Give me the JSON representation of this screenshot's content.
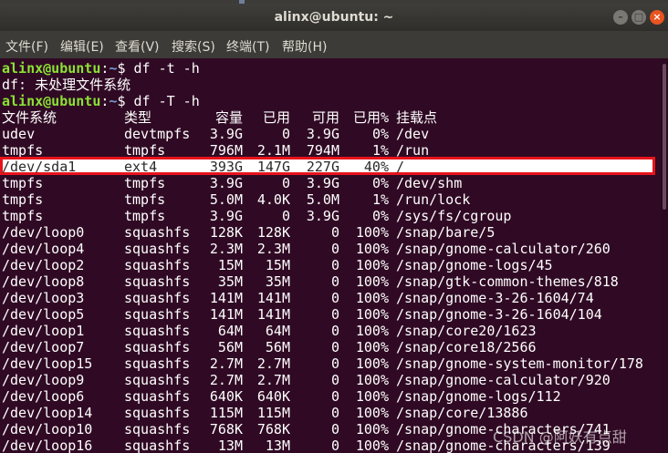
{
  "window": {
    "title": "alinx@ubuntu: ~",
    "minimize_label": "–",
    "maximize_label": "□",
    "close_label": "×"
  },
  "menu": [
    "文件(F)",
    "编辑(E)",
    "查看(V)",
    "搜索(S)",
    "终端(T)",
    "帮助(H)"
  ],
  "prompt": {
    "user_host": "alinx@ubuntu",
    "colon": ":",
    "path": "~",
    "dollar": "$"
  },
  "commands": [
    "df -t -h",
    "df -T -h"
  ],
  "error_line": "df: 未处理文件系统",
  "table": {
    "headers": [
      "文件系统",
      "类型",
      "容量",
      "已用",
      "可用",
      "已用%",
      "挂载点"
    ],
    "rows": [
      [
        "udev",
        "devtmpfs",
        "3.9G",
        "0",
        "3.9G",
        "0%",
        "/dev"
      ],
      [
        "tmpfs",
        "tmpfs",
        "796M",
        "2.1M",
        "794M",
        "1%",
        "/run"
      ],
      [
        "/dev/sda1",
        "ext4",
        "393G",
        "147G",
        "227G",
        "40%",
        "/"
      ],
      [
        "tmpfs",
        "tmpfs",
        "3.9G",
        "0",
        "3.9G",
        "0%",
        "/dev/shm"
      ],
      [
        "tmpfs",
        "tmpfs",
        "5.0M",
        "4.0K",
        "5.0M",
        "1%",
        "/run/lock"
      ],
      [
        "tmpfs",
        "tmpfs",
        "3.9G",
        "0",
        "3.9G",
        "0%",
        "/sys/fs/cgroup"
      ],
      [
        "/dev/loop0",
        "squashfs",
        "128K",
        "128K",
        "0",
        "100%",
        "/snap/bare/5"
      ],
      [
        "/dev/loop4",
        "squashfs",
        "2.3M",
        "2.3M",
        "0",
        "100%",
        "/snap/gnome-calculator/260"
      ],
      [
        "/dev/loop2",
        "squashfs",
        "15M",
        "15M",
        "0",
        "100%",
        "/snap/gnome-logs/45"
      ],
      [
        "/dev/loop8",
        "squashfs",
        "35M",
        "35M",
        "0",
        "100%",
        "/snap/gtk-common-themes/818"
      ],
      [
        "/dev/loop3",
        "squashfs",
        "141M",
        "141M",
        "0",
        "100%",
        "/snap/gnome-3-26-1604/74"
      ],
      [
        "/dev/loop5",
        "squashfs",
        "141M",
        "141M",
        "0",
        "100%",
        "/snap/gnome-3-26-1604/104"
      ],
      [
        "/dev/loop1",
        "squashfs",
        "64M",
        "64M",
        "0",
        "100%",
        "/snap/core20/1623"
      ],
      [
        "/dev/loop7",
        "squashfs",
        "56M",
        "56M",
        "0",
        "100%",
        "/snap/core18/2566"
      ],
      [
        "/dev/loop15",
        "squashfs",
        "2.7M",
        "2.7M",
        "0",
        "100%",
        "/snap/gnome-system-monitor/178"
      ],
      [
        "/dev/loop9",
        "squashfs",
        "2.7M",
        "2.7M",
        "0",
        "100%",
        "/snap/gnome-calculator/920"
      ],
      [
        "/dev/loop6",
        "squashfs",
        "640K",
        "640K",
        "0",
        "100%",
        "/snap/gnome-logs/112"
      ],
      [
        "/dev/loop14",
        "squashfs",
        "115M",
        "115M",
        "0",
        "100%",
        "/snap/core/13886"
      ],
      [
        "/dev/loop10",
        "squashfs",
        "768K",
        "768K",
        "0",
        "100%",
        "/snap/gnome-characters/741"
      ],
      [
        "/dev/loop16",
        "squashfs",
        "13M",
        "13M",
        "0",
        "100%",
        "/snap/gnome-characters/139"
      ]
    ]
  },
  "highlight_row_index": 2,
  "colors": {
    "background": "#300a24",
    "prompt_user": "#8ae234",
    "prompt_path": "#729fcf",
    "highlight_border": "#e8131b"
  },
  "watermark": "CSDN @阿妖有点甜"
}
